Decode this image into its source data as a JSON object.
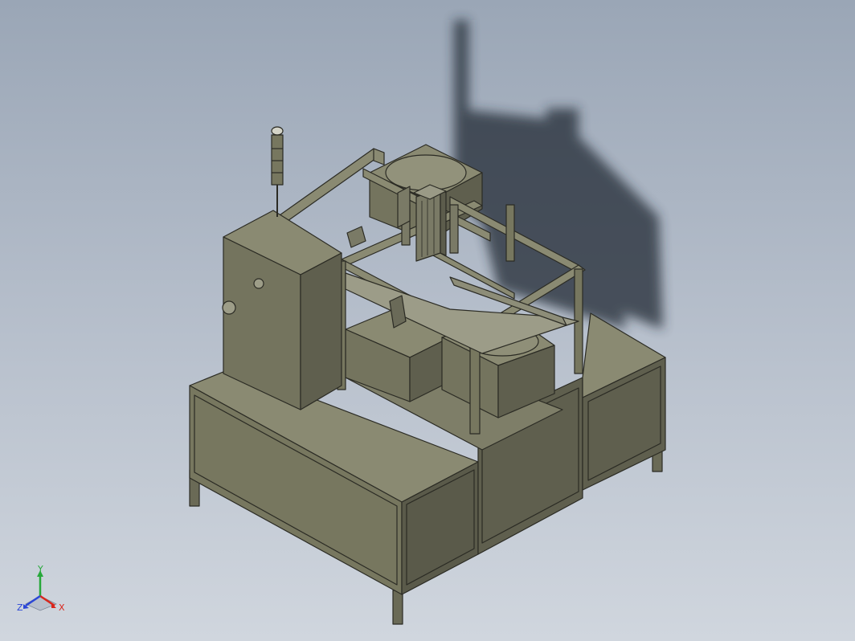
{
  "viewport": {
    "background_top": "#9aa6b6",
    "background_bottom": "#d0d6de"
  },
  "model": {
    "body_color": "#74745e",
    "body_dark": "#5f5f4e",
    "body_light": "#8a8a72",
    "edge_color": "#2b2b24",
    "shadow_color": "#1e2530"
  },
  "triad": {
    "x_label": "X",
    "y_label": "Y",
    "z_label": "Z",
    "x_color": "#d9261c",
    "y_color": "#27a83a",
    "z_color": "#2b46d6"
  }
}
